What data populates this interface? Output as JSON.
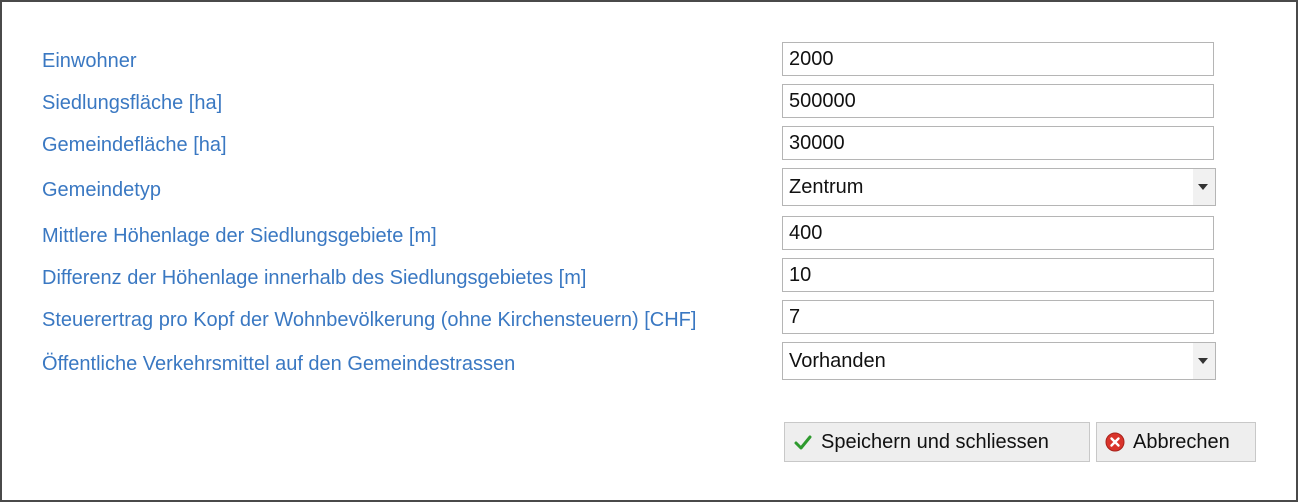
{
  "form": {
    "fields": [
      {
        "label": "Einwohner",
        "value": "2000",
        "type": "input"
      },
      {
        "label": "Siedlungsfläche [ha]",
        "value": "500000",
        "type": "input"
      },
      {
        "label": "Gemeindefläche [ha]",
        "value": "30000",
        "type": "input"
      },
      {
        "label": "Gemeindetyp",
        "value": "Zentrum",
        "type": "select"
      },
      {
        "label": "Mittlere Höhenlage der Siedlungsgebiete [m]",
        "value": "400",
        "type": "input"
      },
      {
        "label": "Differenz der Höhenlage innerhalb des Siedlungsgebietes [m]",
        "value": "10",
        "type": "input"
      },
      {
        "label": "Steuerertrag pro Kopf der Wohnbevölkerung (ohne Kirchensteuern) [CHF]",
        "value": "7",
        "type": "input"
      },
      {
        "label": "Öffentliche Verkehrsmittel auf den Gemeindestrassen",
        "value": "Vorhanden",
        "type": "select"
      }
    ]
  },
  "buttons": {
    "save_label": "Speichern und schliessen",
    "save_icon": "checkmark-icon",
    "cancel_label": "Abbrechen",
    "cancel_icon": "cancel-icon"
  },
  "colors": {
    "label": "#3a78c2",
    "check": "#2e9a2e",
    "cancel": "#d9342b"
  }
}
